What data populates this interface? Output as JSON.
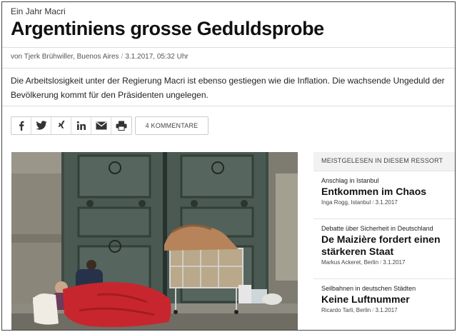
{
  "article": {
    "kicker": "Ein Jahr Macri",
    "headline": "Argentiniens grosse Geduldsprobe",
    "author": "von Tjerk Brühwiller, Buenos Aires",
    "date": "3.1.2017, 05:32 Uhr",
    "lead": "Die Arbeitslosigkeit unter der Regierung Macri ist ebenso gestiegen wie die Inflation. Die wachsende Ungeduld der Bevölkerung kommt für den Präsidenten ungelegen."
  },
  "share": {
    "icons": [
      "facebook-icon",
      "twitter-icon",
      "xing-icon",
      "linkedin-icon",
      "email-icon",
      "print-icon"
    ],
    "comments_label": "4 KOMMENTARE"
  },
  "sidebar": {
    "heading": "MEISTGELESEN IN DIESEM RESSORT",
    "items": [
      {
        "kicker": "Anschlag in Istanbul",
        "title": "Entkommen im Chaos",
        "author": "Inga Rogg, Istanbul",
        "date": "3.1.2017"
      },
      {
        "kicker": "Debatte über Sicherheit in Deutschland",
        "title": "De Maizière fordert einen stärkeren Staat",
        "author": "Markus Ackeret, Berlin",
        "date": "3.1.2017"
      },
      {
        "kicker": "Seilbahnen in deutschen Städten",
        "title": "Keine Luftnummer",
        "author": "Ricardo Tarli, Berlin",
        "date": "3.1.2017"
      }
    ]
  },
  "colors": {
    "text": "#111111",
    "muted": "#555555",
    "rule": "#dddddd",
    "sidebar_head_bg": "#f2f2f2"
  }
}
